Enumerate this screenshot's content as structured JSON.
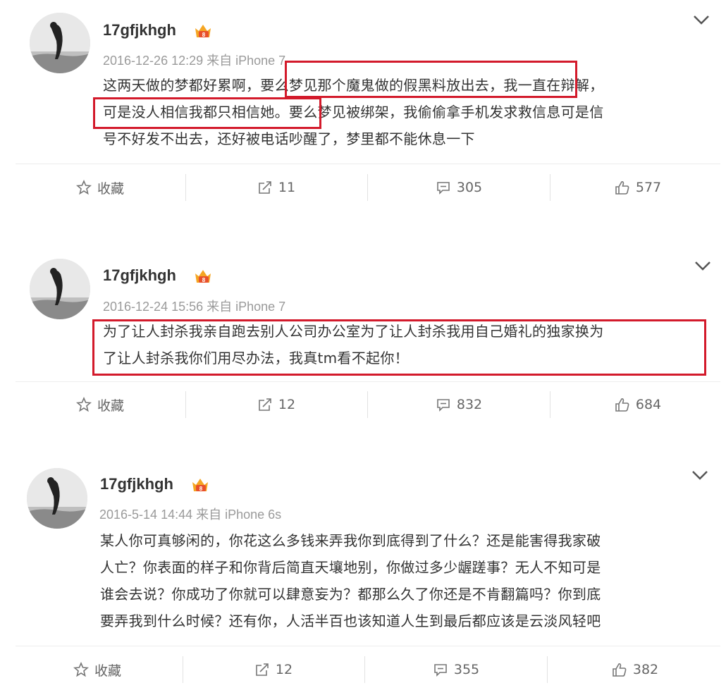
{
  "posts": [
    {
      "user": "17gfjkhgh",
      "meta": "2016-12-26 12:29 来自 iPhone 7",
      "lines": [
        "这两天做的梦都好累啊，要么梦见那个魔鬼做的假黑料放出去，我一直在辩解，",
        "可是没人相信我都只相信她。要么梦见被绑架，我偷偷拿手机发求救信息可是信",
        "号不好发不出去，还好被电话吵醒了，梦里都不能休息一下"
      ],
      "actions": {
        "favorite": "收藏",
        "repost": "11",
        "comment": "305",
        "like": "577"
      }
    },
    {
      "user": "17gfjkhgh",
      "meta": "2016-12-24 15:56 来自 iPhone 7",
      "lines": [
        "为了让人封杀我亲自跑去别人公司办公室为了让人封杀我用自己婚礼的独家换为",
        "了让人封杀我你们用尽办法，我真tm看不起你！"
      ],
      "actions": {
        "favorite": "收藏",
        "repost": "12",
        "comment": "832",
        "like": "684"
      }
    },
    {
      "user": "17gfjkhgh",
      "meta": "2016-5-14 14:44 来自 iPhone 6s",
      "lines": [
        "某人你可真够闲的，你花这么多钱来弄我你到底得到了什么？还是能害得我家破",
        "人亡？你表面的样子和你背后简直天壤地别，你做过多少龌蹉事？无人不知可是",
        "谁会去说？你成功了你就可以肆意妄为？都那么久了你还是不肯翻篇吗？你到底",
        "要弄我到什么时候？还有你，人活半百也该知道人生到最后都应该是云淡风轻吧"
      ],
      "actions": {
        "favorite": "收藏",
        "repost": "12",
        "comment": "355",
        "like": "382"
      }
    }
  ],
  "colors": {
    "highlight": "#d31a2b",
    "vip_gold": "#f5a623",
    "vip_red": "#e8502b"
  },
  "icons": [
    "avatar-photo",
    "vip-crown-icon",
    "chevron-down-icon",
    "star-icon",
    "repost-icon",
    "comment-icon",
    "like-icon"
  ]
}
